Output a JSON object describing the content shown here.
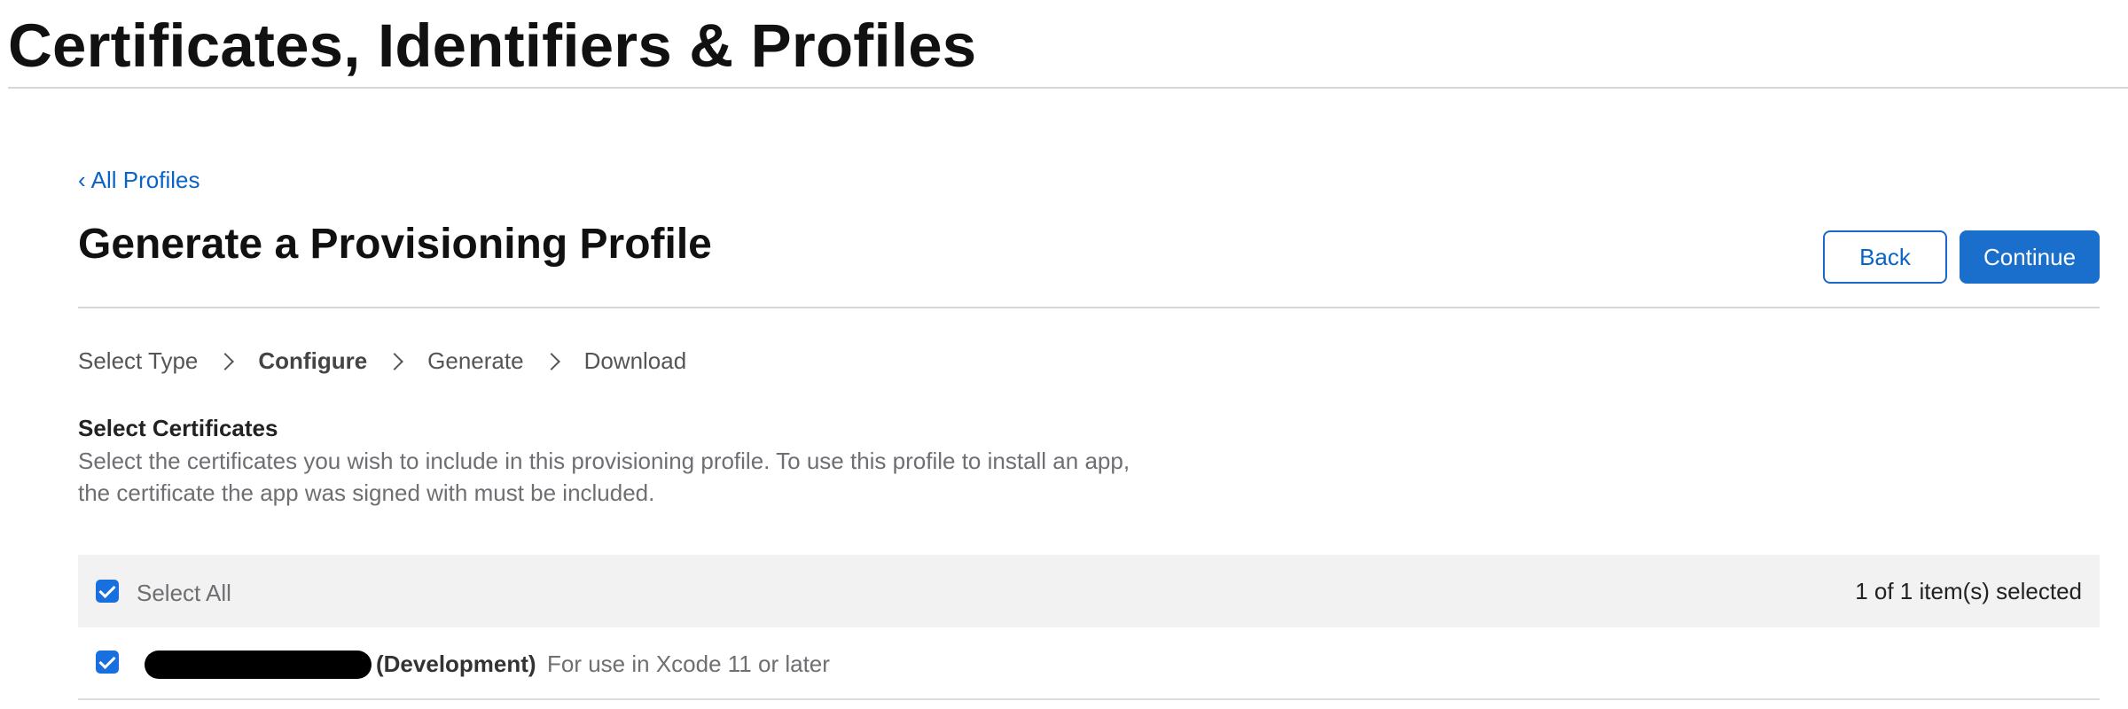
{
  "app": {
    "title": "Certificates, Identifiers & Profiles"
  },
  "nav": {
    "back_link_chevron": "‹",
    "back_link_label": "All Profiles"
  },
  "page": {
    "title": "Generate a Provisioning Profile"
  },
  "actions": {
    "back_label": "Back",
    "continue_label": "Continue"
  },
  "steps": [
    {
      "label": "Select Type",
      "active": false
    },
    {
      "label": "Configure",
      "active": true
    },
    {
      "label": "Generate",
      "active": false
    },
    {
      "label": "Download",
      "active": false
    }
  ],
  "certificates": {
    "heading": "Select Certificates",
    "description_line1": "Select the certificates you wish to include in this provisioning profile. To use this profile to install an app,",
    "description_line2": "the certificate the app was signed with must be included.",
    "select_all_label": "Select All",
    "select_all_checked": true,
    "selected_count": "1 of 1 item(s) selected",
    "items": [
      {
        "type": "(Development)",
        "note": "For use in Xcode 11 or later",
        "checked": true
      }
    ]
  },
  "colors": {
    "accent": "#0a64c8",
    "button_primary": "#1a6fcd",
    "checkbox": "#1a6fe0",
    "header_bg": "#f2f2f2"
  }
}
